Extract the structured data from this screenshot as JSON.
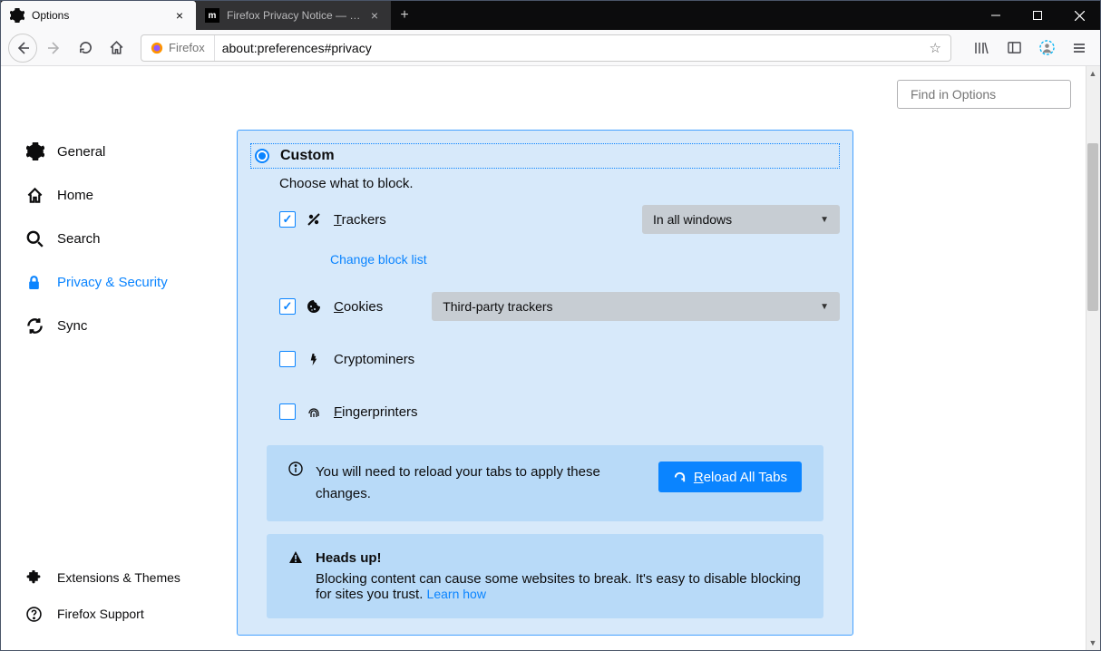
{
  "titlebar": {
    "tabs": [
      {
        "label": "Options",
        "active": true
      },
      {
        "label": "Firefox Privacy Notice — Mozil",
        "active": false
      }
    ]
  },
  "toolbar": {
    "identity_label": "Firefox",
    "url": "about:preferences#privacy"
  },
  "search": {
    "placeholder": "Find in Options"
  },
  "sidebar": {
    "items": [
      {
        "label": "General"
      },
      {
        "label": "Home"
      },
      {
        "label": "Search"
      },
      {
        "label": "Privacy & Security"
      },
      {
        "label": "Sync"
      }
    ],
    "bottom": [
      {
        "label": "Extensions & Themes"
      },
      {
        "label": "Firefox Support"
      }
    ]
  },
  "panel": {
    "radio_label": "Custom",
    "desc": "Choose what to block.",
    "trackers": {
      "label_pre": "T",
      "label_rest": "rackers",
      "dd": "In all windows"
    },
    "change_list": "Change block list",
    "cookies": {
      "label_pre": "C",
      "label_rest": "ookies",
      "dd": "Third-party trackers"
    },
    "crypto": {
      "label": "Cryptominers"
    },
    "finger": {
      "label_pre": "F",
      "label_rest": "ingerprinters"
    },
    "info": {
      "msg": "You will need to reload your tabs to apply these changes.",
      "btn_pre": "R",
      "btn_rest": "eload All Tabs"
    },
    "warn": {
      "title": "Heads up!",
      "msg": "Blocking content can cause some websites to break. It's easy to disable blocking for sites you trust.  ",
      "link": "Learn how"
    }
  }
}
